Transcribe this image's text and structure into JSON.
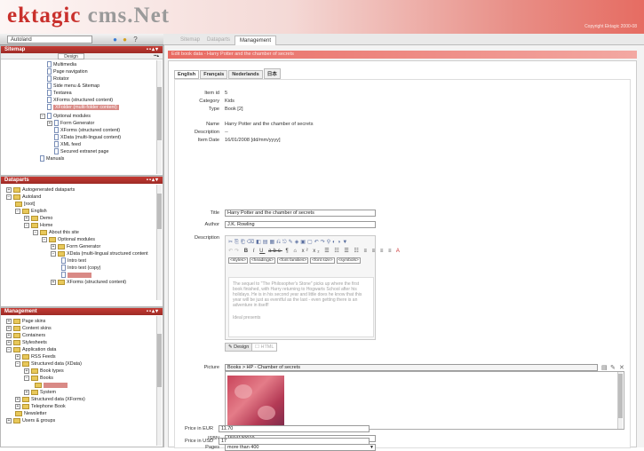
{
  "header": {
    "logo_a": "ektagic",
    "logo_b": " cms.Net",
    "copyright": "Copyright Ektagic 2000-08"
  },
  "site_select": {
    "value": "Autoland"
  },
  "top_tabs": [
    "Sitemap",
    "Dataparts",
    "Management"
  ],
  "sitemap": {
    "title": "Sitemap",
    "subtab": "Design",
    "items": [
      "Multimedia",
      "Page navigation",
      "Rotator",
      "Side menu & Sitemap",
      "Textarea",
      "XForms (structured content)",
      "XFolder (multi-folder content)",
      "Optional modules",
      "Form Generator",
      "XForms (structured content)",
      "XData (multi-lingual content)",
      "XML feed",
      "Secured extranet page",
      "Manuals"
    ]
  },
  "dataparts": {
    "title": "Dataparts",
    "items": [
      "Autogenerated dataparts",
      "Autoland",
      "[root]",
      "English",
      "Demo",
      "Home",
      "About this site",
      "Optional modules",
      "Form Generator",
      "XData (multi-lingual structured content",
      "Intro text",
      "Intro text (copy)",
      "[selected]",
      "XForms (structured content)"
    ]
  },
  "management": {
    "title": "Management",
    "items": [
      "Page skins",
      "Content skins",
      "Containers",
      "Stylesheets",
      "Application data",
      "RSS Feeds",
      "Structured data (XData)",
      "Book types",
      "Books",
      "[selected]",
      "System",
      "Structured data (XForms)",
      "Telephone Book",
      "Newsletter",
      "Users & groups"
    ]
  },
  "main": {
    "title": "Edit book data - Harry Potter and the chamber of secrets",
    "lang_tabs": [
      "English",
      "Français",
      "Nederlands",
      "日本"
    ],
    "meta": {
      "labels": [
        "Item id",
        "Category",
        "Type",
        "Name",
        "Description",
        "Item Date"
      ],
      "values": [
        "5",
        "Kids",
        "Book [2]",
        "Harry Potter and the chamber of secrets",
        "--",
        "16/01/2008  [dd/mm/yyyy]"
      ]
    },
    "title_label": "Title",
    "title_value": "Harry Potter and the chamber of secrets",
    "author_label": "Author",
    "author_value": "J.K. Rowling",
    "description_label": "Description",
    "editor_dropdowns": [
      "<styles>",
      "<headings>",
      "<font families>",
      "<font size>",
      "<symbols>"
    ],
    "editor_p1": "The sequel to \"The Philosopher's Stone\" picks up where the first book finished, with Harry returning to Hogwarts School after his holidays. He is in his second year and little does he know that this year will be just as eventful as the last - even getting there is an adventure in itself!",
    "editor_p2": "Ideal presents",
    "design_btn": "Design",
    "html_btn": "HTML",
    "picture_label": "Picture",
    "picture_value": "Books > HP - Chamber of secrets",
    "isbn_label": "ISBN",
    "isbn_value": "1594130019",
    "pages_label": "Pages",
    "pages_value": "more than 400",
    "eur_label": "Price in EUR",
    "eur_value": "11.70",
    "usd_label": "Price in USD",
    "usd_value": "17"
  },
  "colors": {
    "accent": "#c9302c",
    "panel_header": "#b3322d",
    "title_bar": "#e86a62"
  }
}
